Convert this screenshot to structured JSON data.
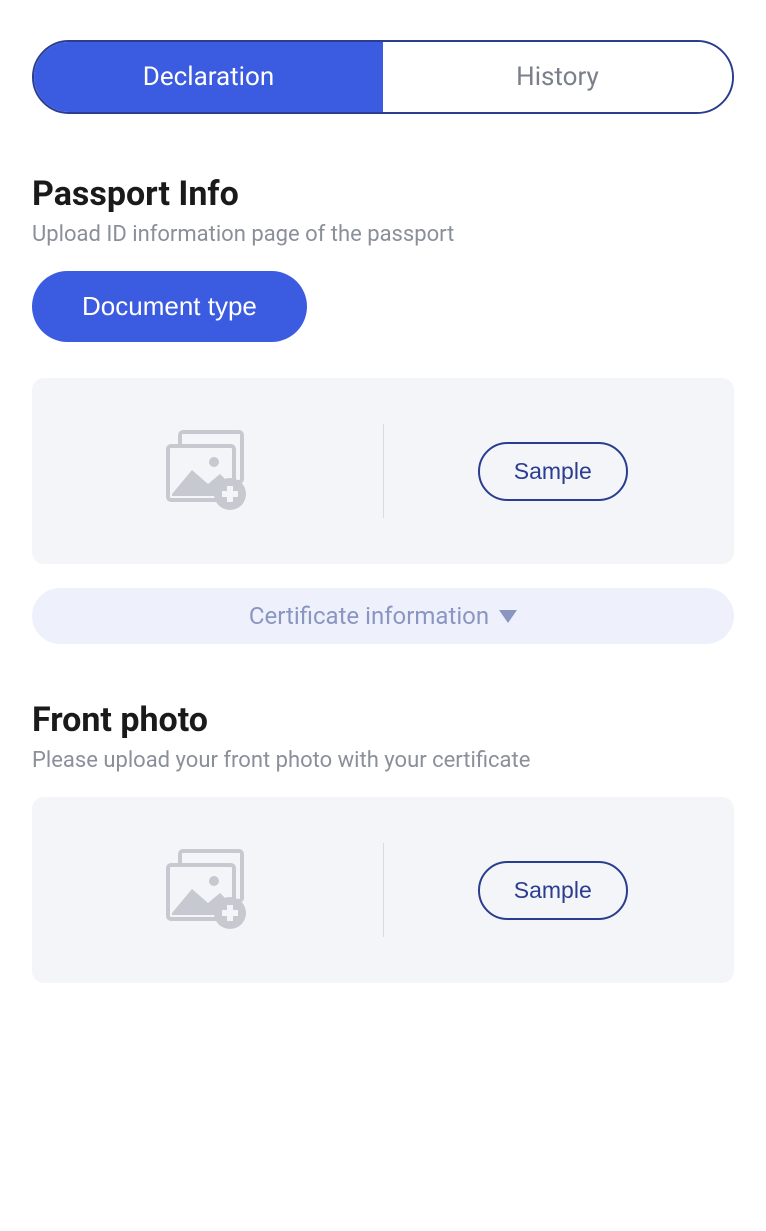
{
  "tabs": {
    "declaration": "Declaration",
    "history": "History"
  },
  "passport": {
    "title": "Passport Info",
    "subtitle": "Upload ID information page of the passport",
    "docTypeBtn": "Document type",
    "sampleBtn": "Sample"
  },
  "certInfo": {
    "label": "Certificate information"
  },
  "frontPhoto": {
    "title": "Front photo",
    "subtitle": "Please upload your front photo with your certificate",
    "sampleBtn": "Sample"
  }
}
